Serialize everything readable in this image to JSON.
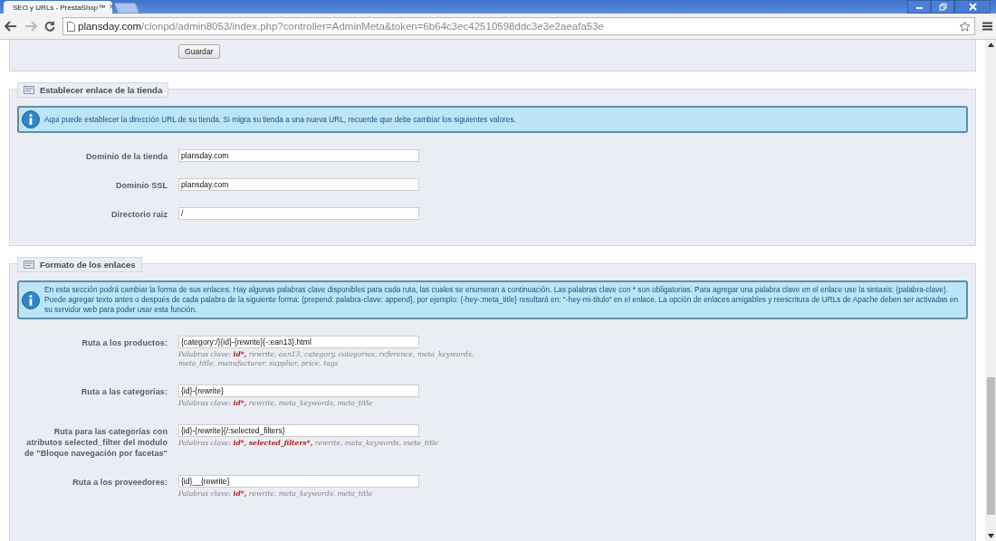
{
  "browser": {
    "tab_title": "SEO y URLs - PrestaShop™",
    "tab_close": "×",
    "url_host": "plansday.com",
    "url_path": "/clonpd/admin8053/index.php?controller=AdminMeta&token=6b64c3ec42510598ddc3e3e2aeafa53e"
  },
  "top_section": {
    "button": "Guardar"
  },
  "sections": [
    {
      "legend": "Establecer enlace de la tienda",
      "info": "Aqui puede establecer la dirección URL de su tienda. Si migra su tienda a una nueva URL, recuerde que debe cambiar los siguientes valores.",
      "fields": [
        {
          "label": "Dominio de la tienda",
          "value": "plansday.com"
        },
        {
          "label": "Dominio SSL",
          "value": "plansday.com"
        },
        {
          "label": "Directorio raiz",
          "value": "/"
        }
      ]
    },
    {
      "legend": "Formato de los enlaces",
      "info": "En esta sección podrá cambiar la forma de sus enlaces. Hay algunas palabras clave disponibles para cada ruta, las cuales se enumeran a continuación. Las palabras clave con * son obligatorias. Para agregar una palabra clave en el enlace use la sintaxis: {palabra-clave}. Puede agregar texto antes o después de cada palabra de la siguiente forma: {prepend: palabra-clave: append}, por ejemplo: {-hey-:meta_title} resultará en: \"-hey-mi-titulo\" en el enlace. La opción de enlaces amigables y reescritura de URLs de Apache deben ser activadas en su servidor web para poder usar esta función.",
      "fields": [
        {
          "label": "Ruta a los productos:",
          "value": "{category:/}{id}-{rewrite}{-:ean13}.html",
          "hint": {
            "prefix": "Palabras clave:",
            "keywords": [
              {
                "text": "id*,",
                "required": true
              },
              {
                "text": "rewrite,",
                "required": false
              },
              {
                "text": "ean13,",
                "required": false
              },
              {
                "text": "category,",
                "required": false
              },
              {
                "text": "categories,",
                "required": false
              },
              {
                "text": "reference,",
                "required": false
              },
              {
                "text": "meta_keywords,",
                "required": false
              },
              {
                "text": "meta_title,",
                "required": false
              },
              {
                "text": "manufacturer,",
                "required": false
              },
              {
                "text": "supplier,",
                "required": false
              },
              {
                "text": "price,",
                "required": false
              },
              {
                "text": "tags",
                "required": false
              }
            ]
          }
        },
        {
          "label": "Ruta a las categorias:",
          "value": "{id}-{rewrite}",
          "hint": {
            "prefix": "Palabras clave:",
            "keywords": [
              {
                "text": "id*,",
                "required": true
              },
              {
                "text": "rewrite,",
                "required": false
              },
              {
                "text": "meta_keywords,",
                "required": false
              },
              {
                "text": "meta_title",
                "required": false
              }
            ]
          }
        },
        {
          "label": "Ruta para las categorías con atributos selected_filter del modulo de \"Bloque navegación por facetas\"",
          "value": "{id}-{rewrite}{/:selected_filters}",
          "hint": {
            "prefix": "Palabras clave:",
            "keywords": [
              {
                "text": "id*,",
                "required": true
              },
              {
                "text": "selected_filters*,",
                "required": true
              },
              {
                "text": "rewrite,",
                "required": false
              },
              {
                "text": "meta_keywords,",
                "required": false
              },
              {
                "text": "meta_title",
                "required": false
              }
            ]
          }
        },
        {
          "label": "Ruta a los proveedores:",
          "value": "{id}__{rewrite}",
          "hint": {
            "prefix": "Palabras clave:",
            "keywords": [
              {
                "text": "id*,",
                "required": true
              },
              {
                "text": "rewrite,",
                "required": false
              },
              {
                "text": "meta_keywords,",
                "required": false
              },
              {
                "text": "meta_title",
                "required": false
              }
            ]
          }
        }
      ]
    }
  ]
}
